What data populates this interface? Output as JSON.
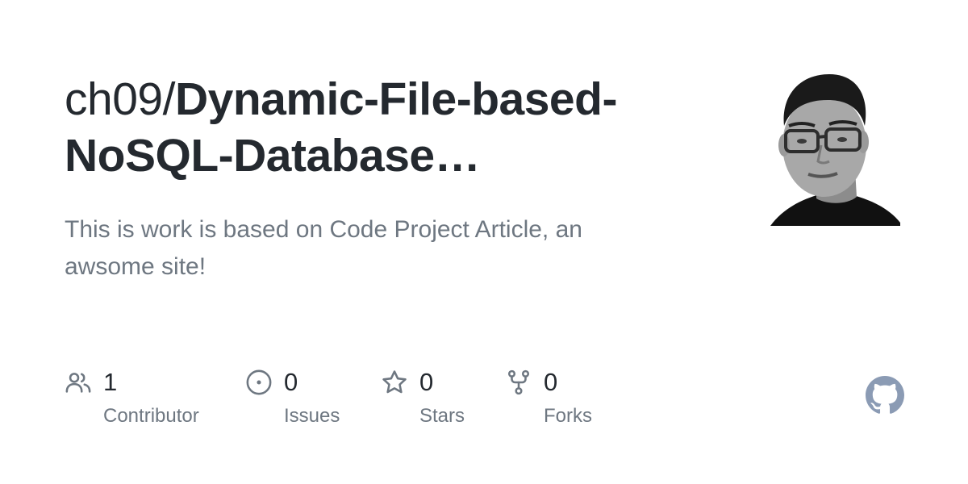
{
  "repo": {
    "owner": "ch09/",
    "name": "Dynamic-File-based-NoSQL-Database…",
    "description": "This is work is based on Code Project Article, an awsome site!"
  },
  "stats": [
    {
      "icon": "people-icon",
      "count": "1",
      "label": "Contributor"
    },
    {
      "icon": "issue-icon",
      "count": "0",
      "label": "Issues"
    },
    {
      "icon": "star-icon",
      "count": "0",
      "label": "Stars"
    },
    {
      "icon": "fork-icon",
      "count": "0",
      "label": "Forks"
    }
  ],
  "colors": {
    "title": "#24292f",
    "muted": "#6e7781",
    "icon": "#6e7781",
    "github_mark": "#8b9bb4"
  }
}
